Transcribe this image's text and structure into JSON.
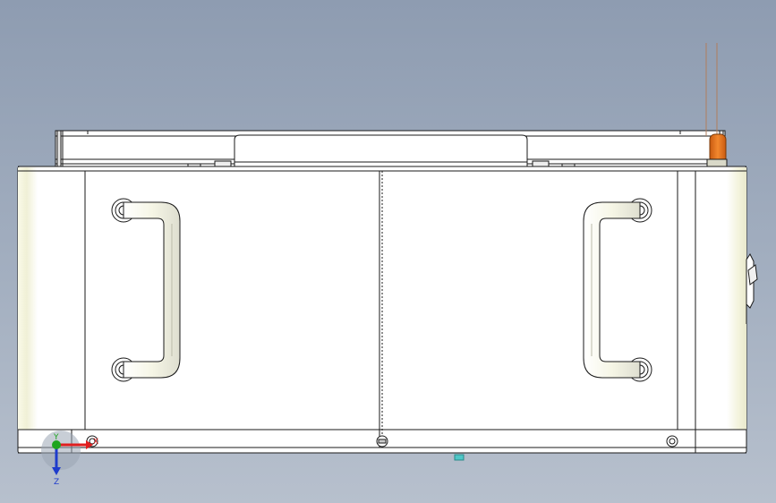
{
  "viewport": {
    "background_top": "#8e9cb1",
    "background_bottom": "#b7c0cd"
  },
  "model": {
    "body_fill": "#ffffff",
    "edge_color": "#1a1a1a",
    "shade_fill": "#f1f1da",
    "accent_color": "#e8731e"
  },
  "triad": {
    "x_color": "#e01e1e",
    "y_color": "#1ea51e",
    "z_color": "#1e3ccc",
    "x_label": "X",
    "y_label": "Y",
    "z_label": "Z",
    "icons": [
      "triad-x-arrow-icon",
      "triad-y-dot-icon",
      "triad-z-arrow-icon"
    ]
  }
}
